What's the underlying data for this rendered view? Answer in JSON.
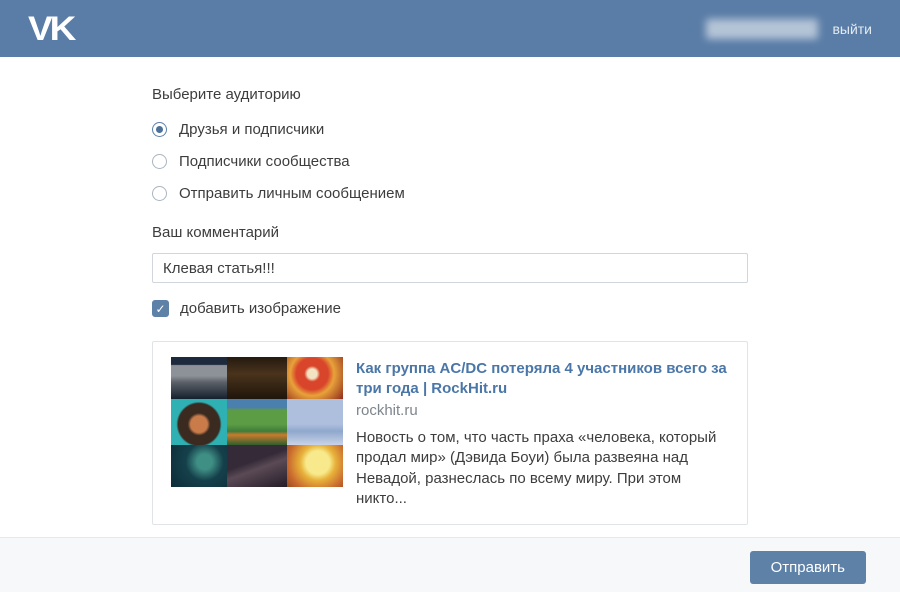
{
  "colors": {
    "header_bg": "#5a7da7",
    "accent": "#5e81a8",
    "link": "#4a76a8"
  },
  "header": {
    "logo_text": "VK",
    "logout_label": "выйти"
  },
  "form": {
    "audience_label": "Выберите аудиторию",
    "audience_options": [
      {
        "label": "Друзья и подписчики",
        "selected": true
      },
      {
        "label": "Подписчики сообщества",
        "selected": false
      },
      {
        "label": "Отправить личным сообщением",
        "selected": false
      }
    ],
    "comment_label": "Ваш комментарий",
    "comment_value": "Клевая статья!!!",
    "add_image_label": "добавить изображение",
    "add_image_checked": true,
    "checkmark_glyph": "✓"
  },
  "preview": {
    "title": "Как группа AC/DC потеряла 4 участников всего за три года | RockHit.ru",
    "domain": "rockhit.ru",
    "description": "Новость о том, что часть праха «человека, который продал мир» (Дэвида Боуи) была развеяна над Невадой, разнеслась по всему миру. При этом никто...",
    "thumbnail_icon": "album-covers-collage"
  },
  "footer": {
    "submit_label": "Отправить"
  }
}
